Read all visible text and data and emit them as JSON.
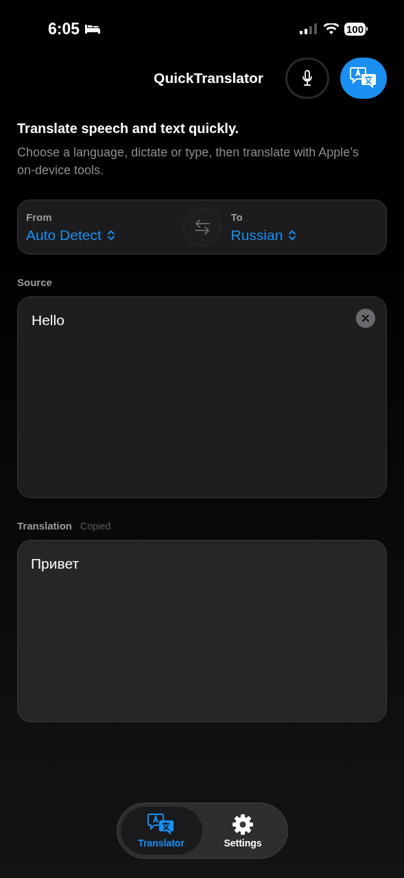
{
  "status_bar": {
    "time": "6:05",
    "battery": "100"
  },
  "header": {
    "title": "QuickTranslator"
  },
  "intro": {
    "title": "Translate speech and text quickly.",
    "subtitle": "Choose a language, dictate or type, then translate with Apple’s on-device tools."
  },
  "languages": {
    "from_label": "From",
    "from_value": "Auto Detect",
    "to_label": "To",
    "to_value": "Russian"
  },
  "source": {
    "label": "Source",
    "value": "Hello"
  },
  "translation": {
    "label": "Translation",
    "status": "Copied",
    "value": "Привет"
  },
  "tabs": [
    {
      "label": "Translator",
      "kind": "translator",
      "selected": true
    },
    {
      "label": "Settings",
      "kind": "settings",
      "selected": false
    }
  ]
}
